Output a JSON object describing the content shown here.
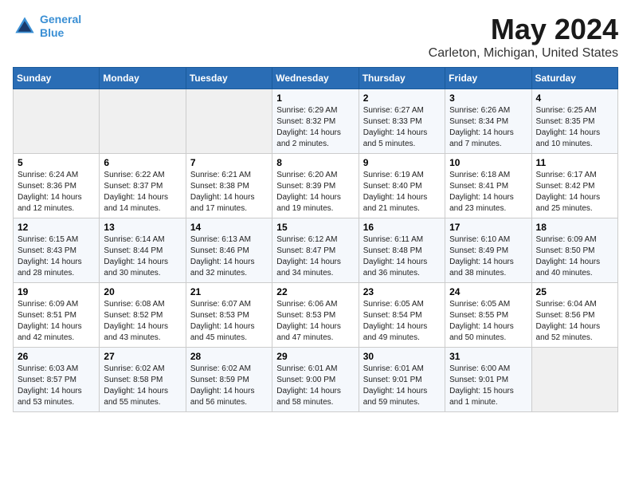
{
  "header": {
    "logo_line1": "General",
    "logo_line2": "Blue",
    "title": "May 2024",
    "subtitle": "Carleton, Michigan, United States"
  },
  "days_of_week": [
    "Sunday",
    "Monday",
    "Tuesday",
    "Wednesday",
    "Thursday",
    "Friday",
    "Saturday"
  ],
  "weeks": [
    [
      {
        "day": "",
        "info": ""
      },
      {
        "day": "",
        "info": ""
      },
      {
        "day": "",
        "info": ""
      },
      {
        "day": "1",
        "info": "Sunrise: 6:29 AM\nSunset: 8:32 PM\nDaylight: 14 hours\nand 2 minutes."
      },
      {
        "day": "2",
        "info": "Sunrise: 6:27 AM\nSunset: 8:33 PM\nDaylight: 14 hours\nand 5 minutes."
      },
      {
        "day": "3",
        "info": "Sunrise: 6:26 AM\nSunset: 8:34 PM\nDaylight: 14 hours\nand 7 minutes."
      },
      {
        "day": "4",
        "info": "Sunrise: 6:25 AM\nSunset: 8:35 PM\nDaylight: 14 hours\nand 10 minutes."
      }
    ],
    [
      {
        "day": "5",
        "info": "Sunrise: 6:24 AM\nSunset: 8:36 PM\nDaylight: 14 hours\nand 12 minutes."
      },
      {
        "day": "6",
        "info": "Sunrise: 6:22 AM\nSunset: 8:37 PM\nDaylight: 14 hours\nand 14 minutes."
      },
      {
        "day": "7",
        "info": "Sunrise: 6:21 AM\nSunset: 8:38 PM\nDaylight: 14 hours\nand 17 minutes."
      },
      {
        "day": "8",
        "info": "Sunrise: 6:20 AM\nSunset: 8:39 PM\nDaylight: 14 hours\nand 19 minutes."
      },
      {
        "day": "9",
        "info": "Sunrise: 6:19 AM\nSunset: 8:40 PM\nDaylight: 14 hours\nand 21 minutes."
      },
      {
        "day": "10",
        "info": "Sunrise: 6:18 AM\nSunset: 8:41 PM\nDaylight: 14 hours\nand 23 minutes."
      },
      {
        "day": "11",
        "info": "Sunrise: 6:17 AM\nSunset: 8:42 PM\nDaylight: 14 hours\nand 25 minutes."
      }
    ],
    [
      {
        "day": "12",
        "info": "Sunrise: 6:15 AM\nSunset: 8:43 PM\nDaylight: 14 hours\nand 28 minutes."
      },
      {
        "day": "13",
        "info": "Sunrise: 6:14 AM\nSunset: 8:44 PM\nDaylight: 14 hours\nand 30 minutes."
      },
      {
        "day": "14",
        "info": "Sunrise: 6:13 AM\nSunset: 8:46 PM\nDaylight: 14 hours\nand 32 minutes."
      },
      {
        "day": "15",
        "info": "Sunrise: 6:12 AM\nSunset: 8:47 PM\nDaylight: 14 hours\nand 34 minutes."
      },
      {
        "day": "16",
        "info": "Sunrise: 6:11 AM\nSunset: 8:48 PM\nDaylight: 14 hours\nand 36 minutes."
      },
      {
        "day": "17",
        "info": "Sunrise: 6:10 AM\nSunset: 8:49 PM\nDaylight: 14 hours\nand 38 minutes."
      },
      {
        "day": "18",
        "info": "Sunrise: 6:09 AM\nSunset: 8:50 PM\nDaylight: 14 hours\nand 40 minutes."
      }
    ],
    [
      {
        "day": "19",
        "info": "Sunrise: 6:09 AM\nSunset: 8:51 PM\nDaylight: 14 hours\nand 42 minutes."
      },
      {
        "day": "20",
        "info": "Sunrise: 6:08 AM\nSunset: 8:52 PM\nDaylight: 14 hours\nand 43 minutes."
      },
      {
        "day": "21",
        "info": "Sunrise: 6:07 AM\nSunset: 8:53 PM\nDaylight: 14 hours\nand 45 minutes."
      },
      {
        "day": "22",
        "info": "Sunrise: 6:06 AM\nSunset: 8:53 PM\nDaylight: 14 hours\nand 47 minutes."
      },
      {
        "day": "23",
        "info": "Sunrise: 6:05 AM\nSunset: 8:54 PM\nDaylight: 14 hours\nand 49 minutes."
      },
      {
        "day": "24",
        "info": "Sunrise: 6:05 AM\nSunset: 8:55 PM\nDaylight: 14 hours\nand 50 minutes."
      },
      {
        "day": "25",
        "info": "Sunrise: 6:04 AM\nSunset: 8:56 PM\nDaylight: 14 hours\nand 52 minutes."
      }
    ],
    [
      {
        "day": "26",
        "info": "Sunrise: 6:03 AM\nSunset: 8:57 PM\nDaylight: 14 hours\nand 53 minutes."
      },
      {
        "day": "27",
        "info": "Sunrise: 6:02 AM\nSunset: 8:58 PM\nDaylight: 14 hours\nand 55 minutes."
      },
      {
        "day": "28",
        "info": "Sunrise: 6:02 AM\nSunset: 8:59 PM\nDaylight: 14 hours\nand 56 minutes."
      },
      {
        "day": "29",
        "info": "Sunrise: 6:01 AM\nSunset: 9:00 PM\nDaylight: 14 hours\nand 58 minutes."
      },
      {
        "day": "30",
        "info": "Sunrise: 6:01 AM\nSunset: 9:01 PM\nDaylight: 14 hours\nand 59 minutes."
      },
      {
        "day": "31",
        "info": "Sunrise: 6:00 AM\nSunset: 9:01 PM\nDaylight: 15 hours\nand 1 minute."
      },
      {
        "day": "",
        "info": ""
      }
    ]
  ]
}
